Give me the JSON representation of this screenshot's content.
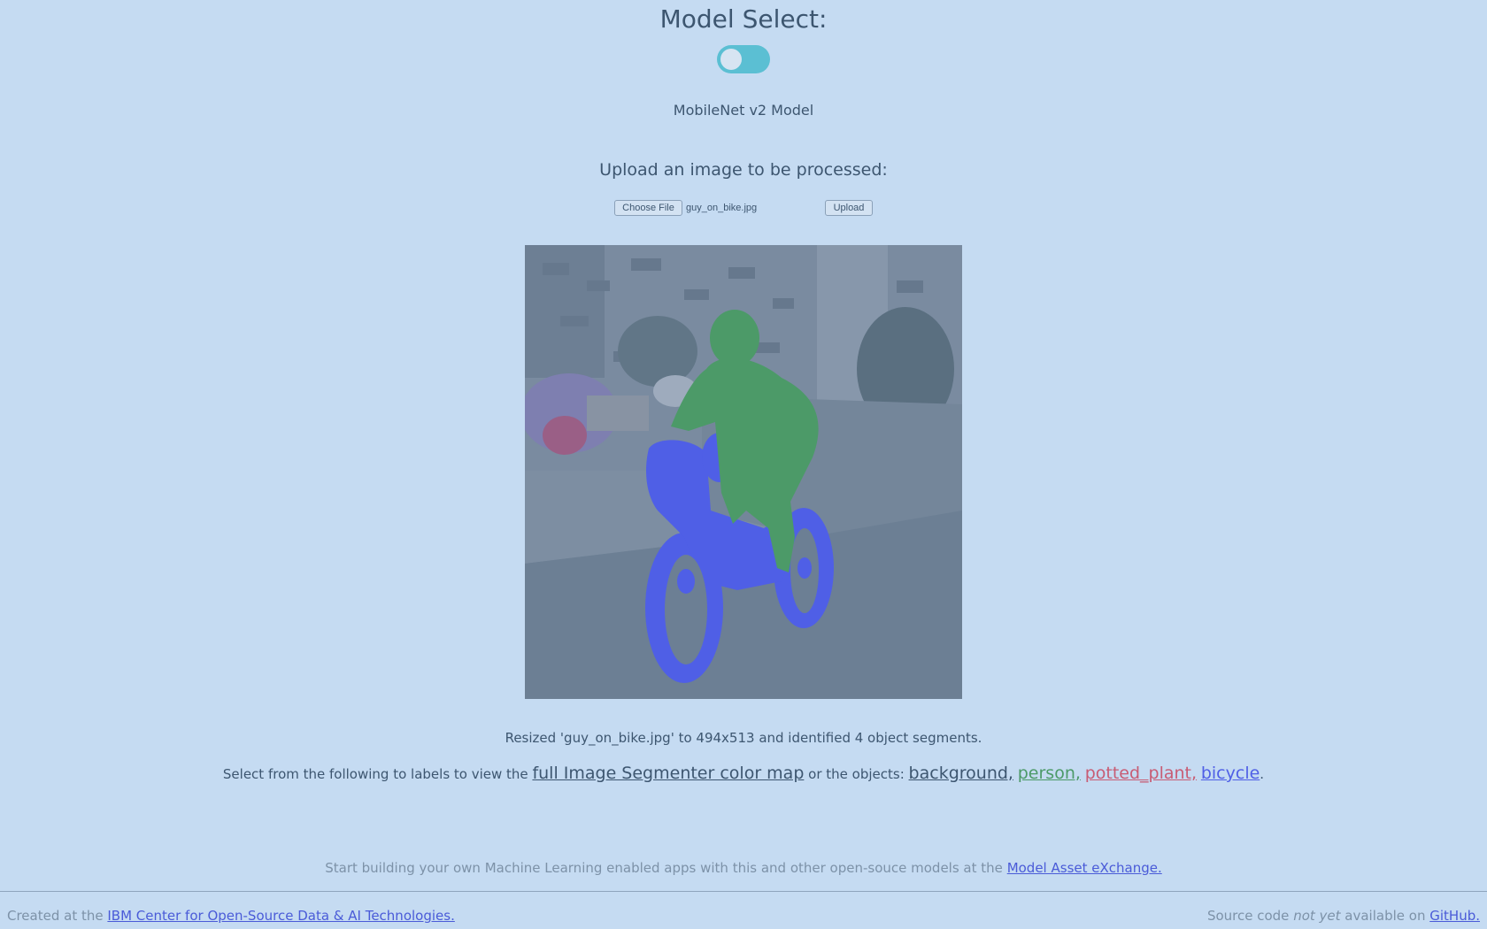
{
  "header": {
    "title": "Model Select:",
    "toggle_state": "off",
    "model_name": "MobileNet v2 Model"
  },
  "upload": {
    "heading": "Upload an image to be processed:",
    "choose_label": "Choose File",
    "file_name": "guy_on_bike.jpg",
    "upload_label": "Upload"
  },
  "result": {
    "status": "Resized 'guy_on_bike.jpg' to 494x513 and identified 4 object segments.",
    "select_prefix": "Select from the following to labels to view the",
    "colormap_link": "full Image Segmenter color map",
    "select_middle": "or the objects:",
    "labels": [
      {
        "text": "background,",
        "color": "#3d5670"
      },
      {
        "text": "person,",
        "color": "#4c9a68"
      },
      {
        "text": "potted_plant,",
        "color": "#c85c74"
      },
      {
        "text": "bicycle",
        "color": "#4f5fe6"
      }
    ],
    "select_suffix": "."
  },
  "footer": {
    "message_prefix": "Start building your own Machine Learning enabled apps with this and other open-souce models at the",
    "message_link": "Model Asset eXchange.",
    "left_prefix": "Created at the",
    "left_link": "IBM Center for Open-Source Data & AI Technologies.",
    "right_prefix": "Source code",
    "right_em": "not yet",
    "right_middle": "available on",
    "right_link": "GitHub."
  },
  "colors": {
    "page_background": "#c5dbf2",
    "toggle": "#5bbfd3",
    "person_mask": "#4c9a68",
    "bicycle_mask": "#4f5fe6",
    "potted_plant_mask": "#c85c74"
  }
}
